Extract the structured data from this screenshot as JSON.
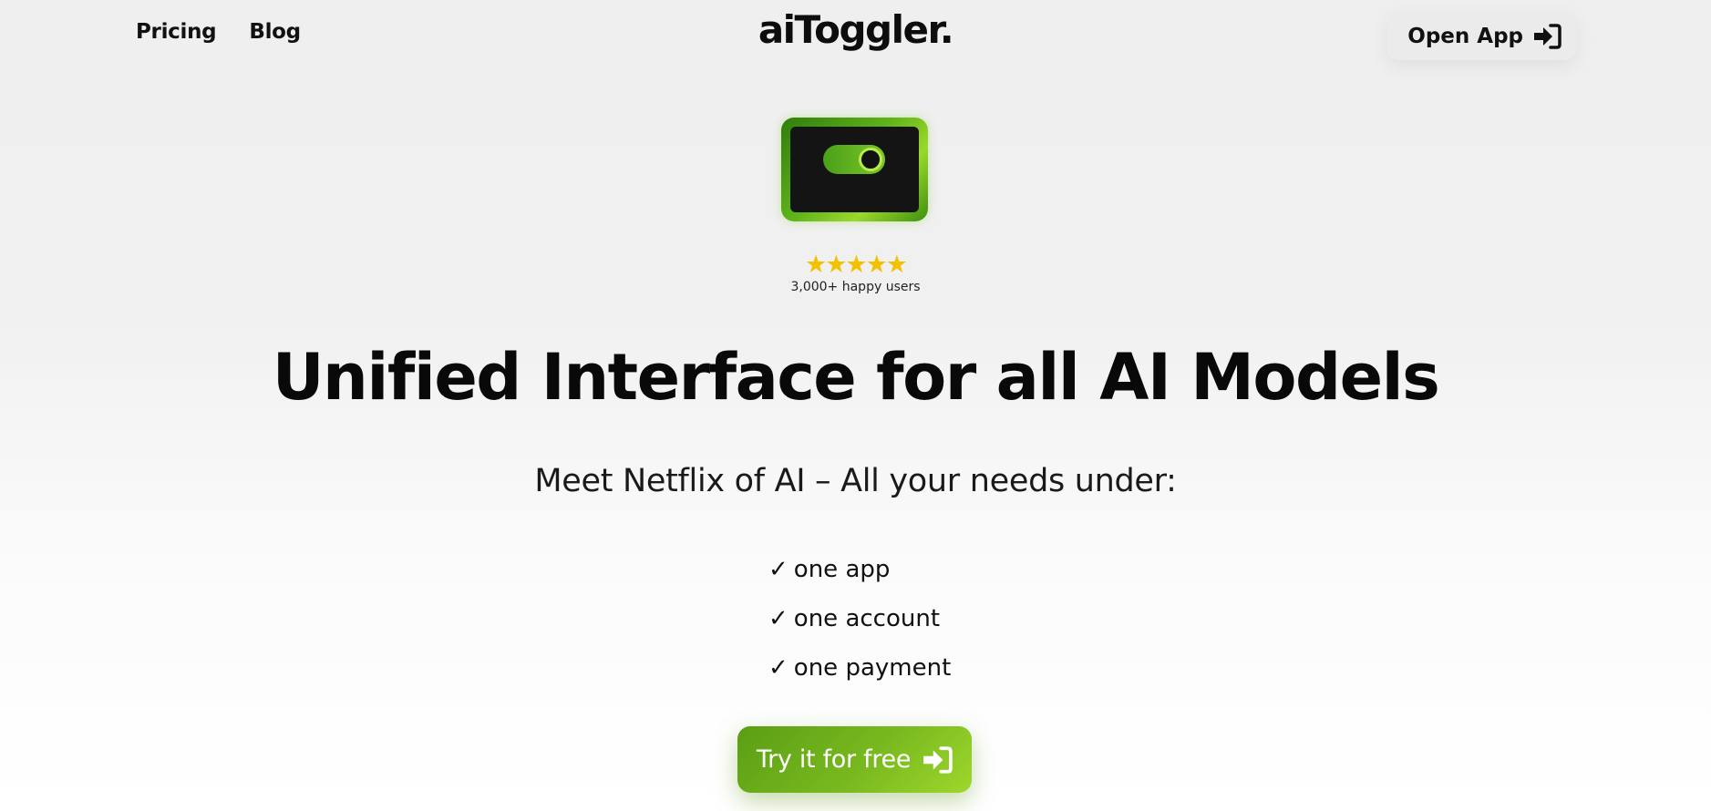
{
  "nav": {
    "pricing": "Pricing",
    "blog": "Blog"
  },
  "brand": {
    "logo": "aiToggler."
  },
  "header": {
    "open_app_label": "Open App",
    "open_app_icon": "sign-in-icon"
  },
  "hero": {
    "app_icon": "toggle-switch-icon",
    "stars": "★★★★★",
    "star_color": "#f2c200",
    "users_text": "3,000+ happy users",
    "headline": "Unified Interface for all AI Models",
    "subheadline": "Meet Netflix of AI – All your needs under:",
    "features": [
      {
        "check": "✓",
        "text": "one app"
      },
      {
        "check": "✓",
        "text": "one account"
      },
      {
        "check": "✓",
        "text": "one payment"
      }
    ],
    "cta_label": "Try it for free",
    "cta_icon": "sign-in-icon",
    "accent_color": "#79b91f"
  }
}
